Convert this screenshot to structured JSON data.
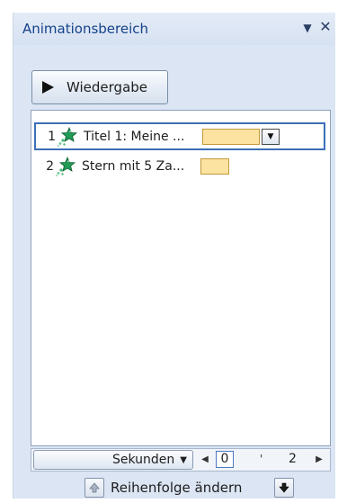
{
  "pane": {
    "title": "Animationsbereich",
    "menu_icon": "chevron-down-icon",
    "close_icon": "close-icon",
    "close_glyph": "✕"
  },
  "toolbar": {
    "play_label": "Wiedergabe",
    "play_icon": "play-icon"
  },
  "animations": [
    {
      "number": "1",
      "label": "Titel 1: Meine ...",
      "icon": "star-effect-icon",
      "selected": true,
      "timing_color": "#fde3a1"
    },
    {
      "number": "2",
      "label": "Stern mit 5 Za...",
      "icon": "star-effect-icon",
      "selected": false,
      "timing_color": "#fde3a1"
    }
  ],
  "timeline": {
    "unit_label": "Sekunden",
    "start_value": "0",
    "end_value": "2"
  },
  "reorder": {
    "label": "Reihenfolge ändern",
    "up_icon": "arrow-up-icon",
    "down_icon": "arrow-down-icon"
  },
  "colors": {
    "pane_background": "#dbe5f3",
    "title_text": "#15428b",
    "selection_border": "#3c6fb7",
    "timing_bar": "#fde3a1"
  }
}
